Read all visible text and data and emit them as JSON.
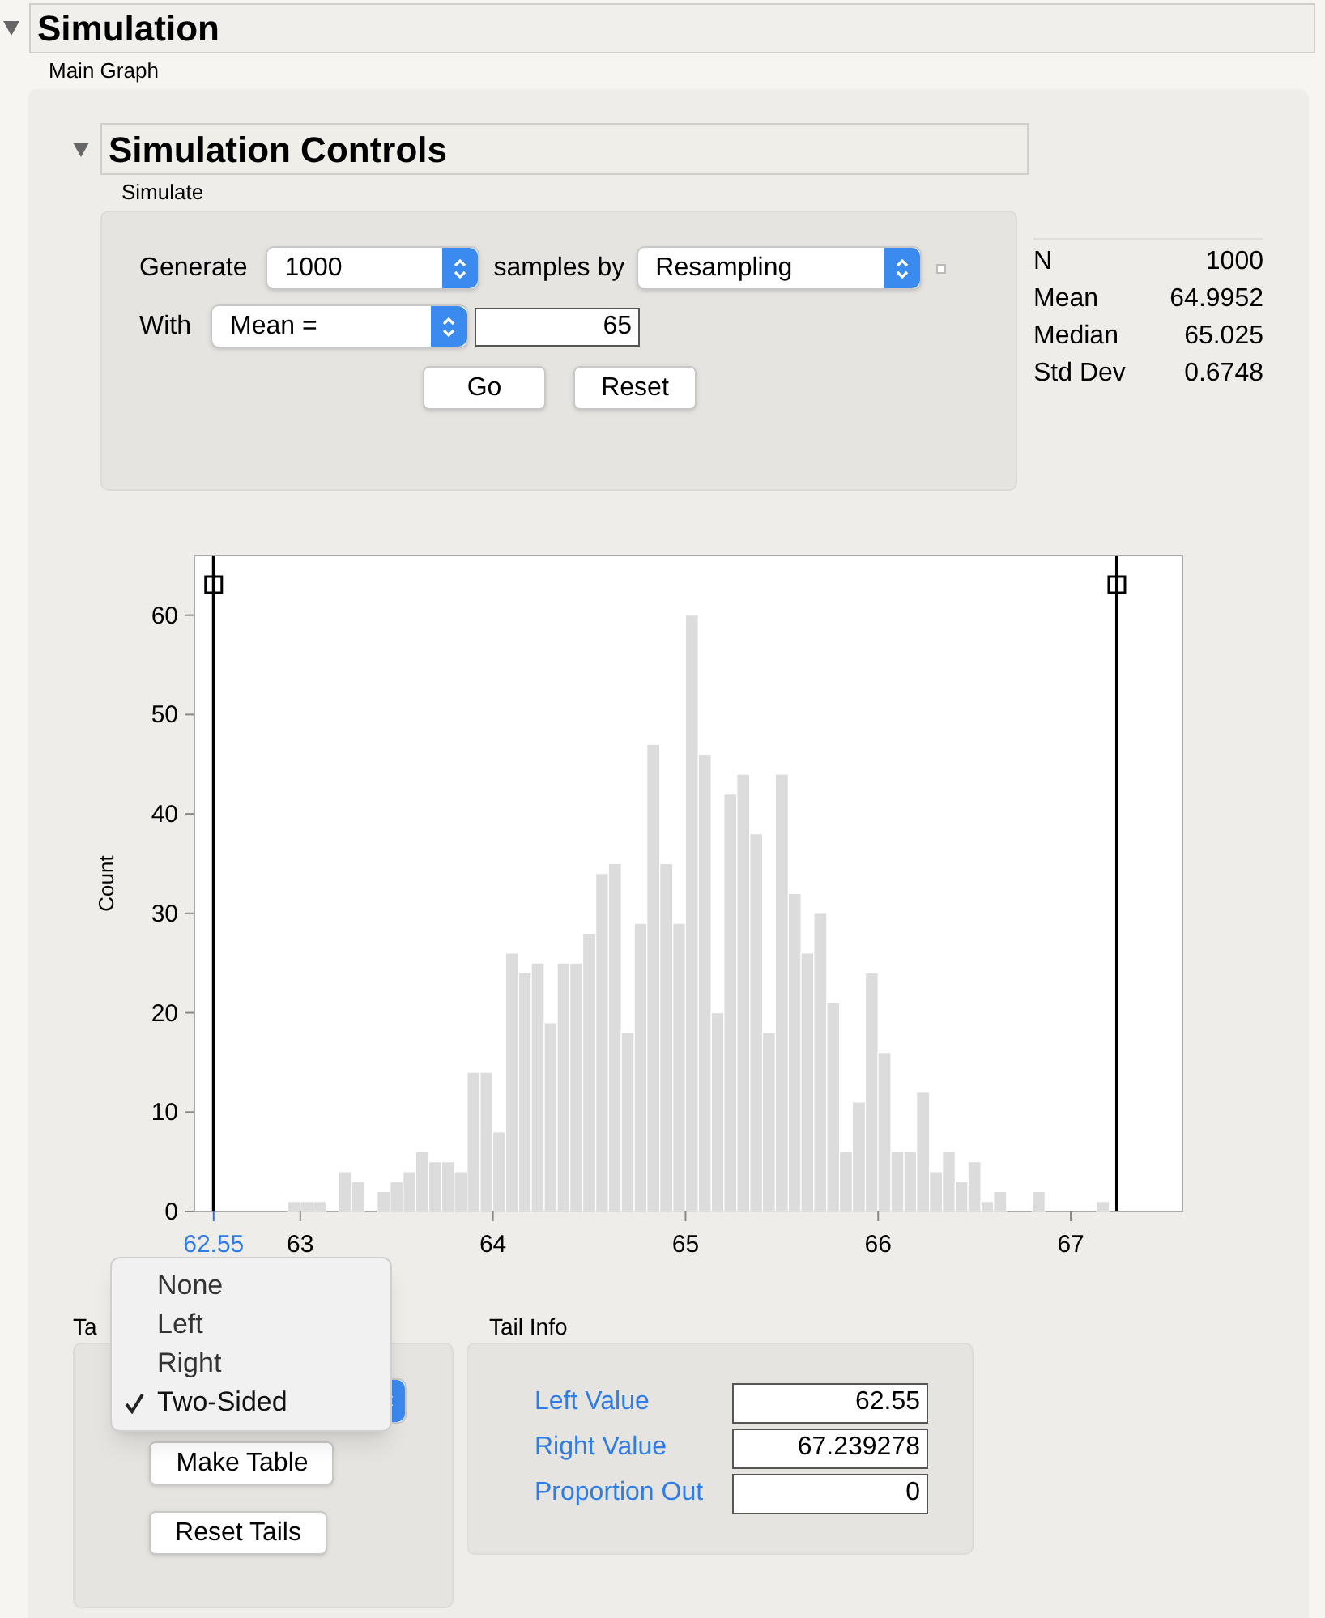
{
  "section": {
    "title": "Simulation",
    "expanded": true,
    "caption": "Main Graph"
  },
  "controls": {
    "title": "Simulation Controls",
    "expanded": true,
    "caption": "Simulate",
    "generate_label": "Generate",
    "generate_value": "1000",
    "samples_by_label": "samples by",
    "method_value": "Resampling",
    "with_label": "With",
    "statistic_value": "Mean =",
    "statistic_input": "65",
    "option_checked": false,
    "buttons": [
      "Go",
      "Reset"
    ]
  },
  "stats": [
    {
      "label": "N",
      "value": "1000"
    },
    {
      "label": "Mean",
      "value": "64.9952"
    },
    {
      "label": "Median",
      "value": "65.025"
    },
    {
      "label": "Std Dev",
      "value": "0.6748"
    }
  ],
  "graph": {
    "chart_data": {
      "type": "bar",
      "ylabel": "Count",
      "x": [
        62.967,
        63.033,
        63.1,
        63.167,
        63.233,
        63.3,
        63.367,
        63.433,
        63.5,
        63.567,
        63.633,
        63.7,
        63.767,
        63.833,
        63.9,
        63.967,
        64.033,
        64.1,
        64.167,
        64.233,
        64.3,
        64.367,
        64.433,
        64.5,
        64.567,
        64.633,
        64.7,
        64.767,
        64.833,
        64.9,
        64.967,
        65.033,
        65.1,
        65.167,
        65.233,
        65.3,
        65.367,
        65.433,
        65.5,
        65.567,
        65.633,
        65.7,
        65.767,
        65.833,
        65.9,
        65.967,
        66.033,
        66.1,
        66.167,
        66.233,
        66.3,
        66.367,
        66.433,
        66.5,
        66.567,
        66.633,
        66.7,
        66.767,
        66.833,
        66.9,
        66.967,
        67.033,
        67.1,
        67.167
      ],
      "series": [
        {
          "color": "#dcdcdc",
          "values": [
            1,
            1,
            1,
            0,
            4,
            3,
            0,
            2,
            3,
            4,
            6,
            5,
            5,
            4,
            14,
            14,
            8,
            26,
            24,
            25,
            19,
            25,
            25,
            28,
            34,
            35,
            18,
            29,
            47,
            35,
            29,
            60,
            46,
            20,
            42,
            44,
            38,
            18,
            44,
            32,
            26,
            30,
            21,
            6,
            11,
            24,
            16,
            6,
            6,
            12,
            4,
            6,
            3,
            5,
            1,
            2,
            0,
            0,
            2,
            0,
            0,
            0,
            0,
            1
          ]
        }
      ],
      "xlim": [
        62.45,
        67.58
      ],
      "ylim": [
        0,
        66
      ],
      "xticks": [
        {
          "value": 62.55,
          "label": "62.55"
        },
        63,
        64,
        65,
        66,
        67
      ],
      "yticks": [
        0,
        10,
        20,
        30,
        40,
        50,
        60
      ],
      "ref_lines": [
        {
          "axis": "x",
          "value": 62.55
        },
        {
          "axis": "x",
          "value": 67.239278
        }
      ]
    }
  },
  "tails": {
    "title": "Ta",
    "menu": [
      {
        "label": "None",
        "selected": false
      },
      {
        "label": "Left",
        "selected": false
      },
      {
        "label": "Right",
        "selected": false
      },
      {
        "label": "Two-Sided",
        "selected": true
      }
    ],
    "buttons": [
      "Make Table",
      "Reset Tails"
    ]
  },
  "tail_info": {
    "title": "Tail Info",
    "rows": [
      {
        "label": "Left Value",
        "value": "62.55"
      },
      {
        "label": "Right Value",
        "value": "67.239278"
      },
      {
        "label": "Proportion Out",
        "value": "0"
      }
    ]
  }
}
